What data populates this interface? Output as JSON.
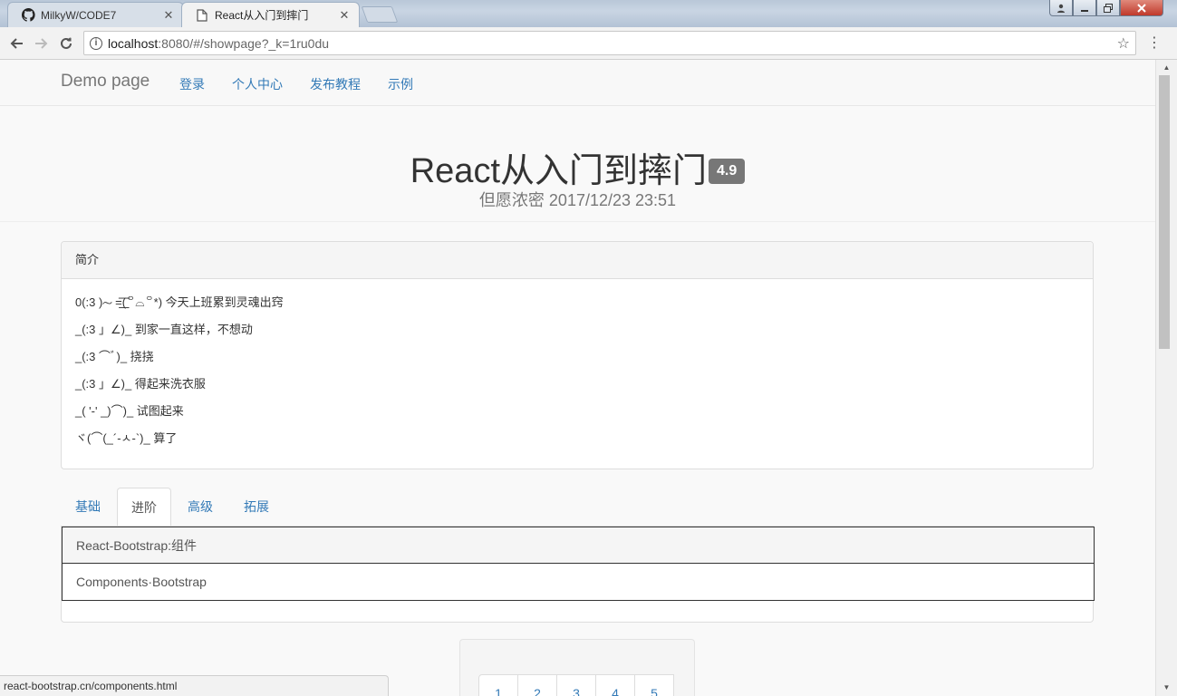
{
  "browser": {
    "tabs": [
      {
        "title": "MilkyW/CODE7",
        "icon": "github-icon",
        "active": false
      },
      {
        "title": "React从入门到摔门",
        "icon": "page-icon",
        "active": true
      }
    ],
    "close_glyph": "✕",
    "url_host": "localhost",
    "url_path": ":8080/#/showpage?_k=1ru0du",
    "status_text": "react-bootstrap.cn/components.html"
  },
  "navbar": {
    "brand": "Demo page",
    "links": [
      "登录",
      "个人中心",
      "发布教程",
      "示例"
    ]
  },
  "header": {
    "title": "React从入门到摔门",
    "rating": "4.9",
    "subtitle": "但愿浓密 2017/12/23 23:51"
  },
  "intro": {
    "heading": "简介",
    "lines": [
      "0(:3 )～ =͟͟͞͞(꒪⌓꒪*) 今天上班累到灵魂出窍",
      "_(:3 」∠)_ 到家一直这样，不想动",
      "_(:3 ⌒ﾞ)_ 挠挠",
      "_(:3 」∠)_ 得起来洗衣服",
      "_( '-' _)⌒)_ 试图起来",
      "ヾ(⌒(_´-ㅅ-`)_ 算了"
    ]
  },
  "tabs": {
    "items": [
      "基础",
      "进阶",
      "高级",
      "拓展"
    ],
    "active_index": 1
  },
  "content": {
    "items": [
      "React-Bootstrap:组件",
      "Components·Bootstrap"
    ]
  },
  "pagination": {
    "pages": [
      "1",
      "2",
      "3",
      "4",
      "5"
    ]
  },
  "colors": {
    "link": "#337ab7",
    "badge": "#777777"
  }
}
